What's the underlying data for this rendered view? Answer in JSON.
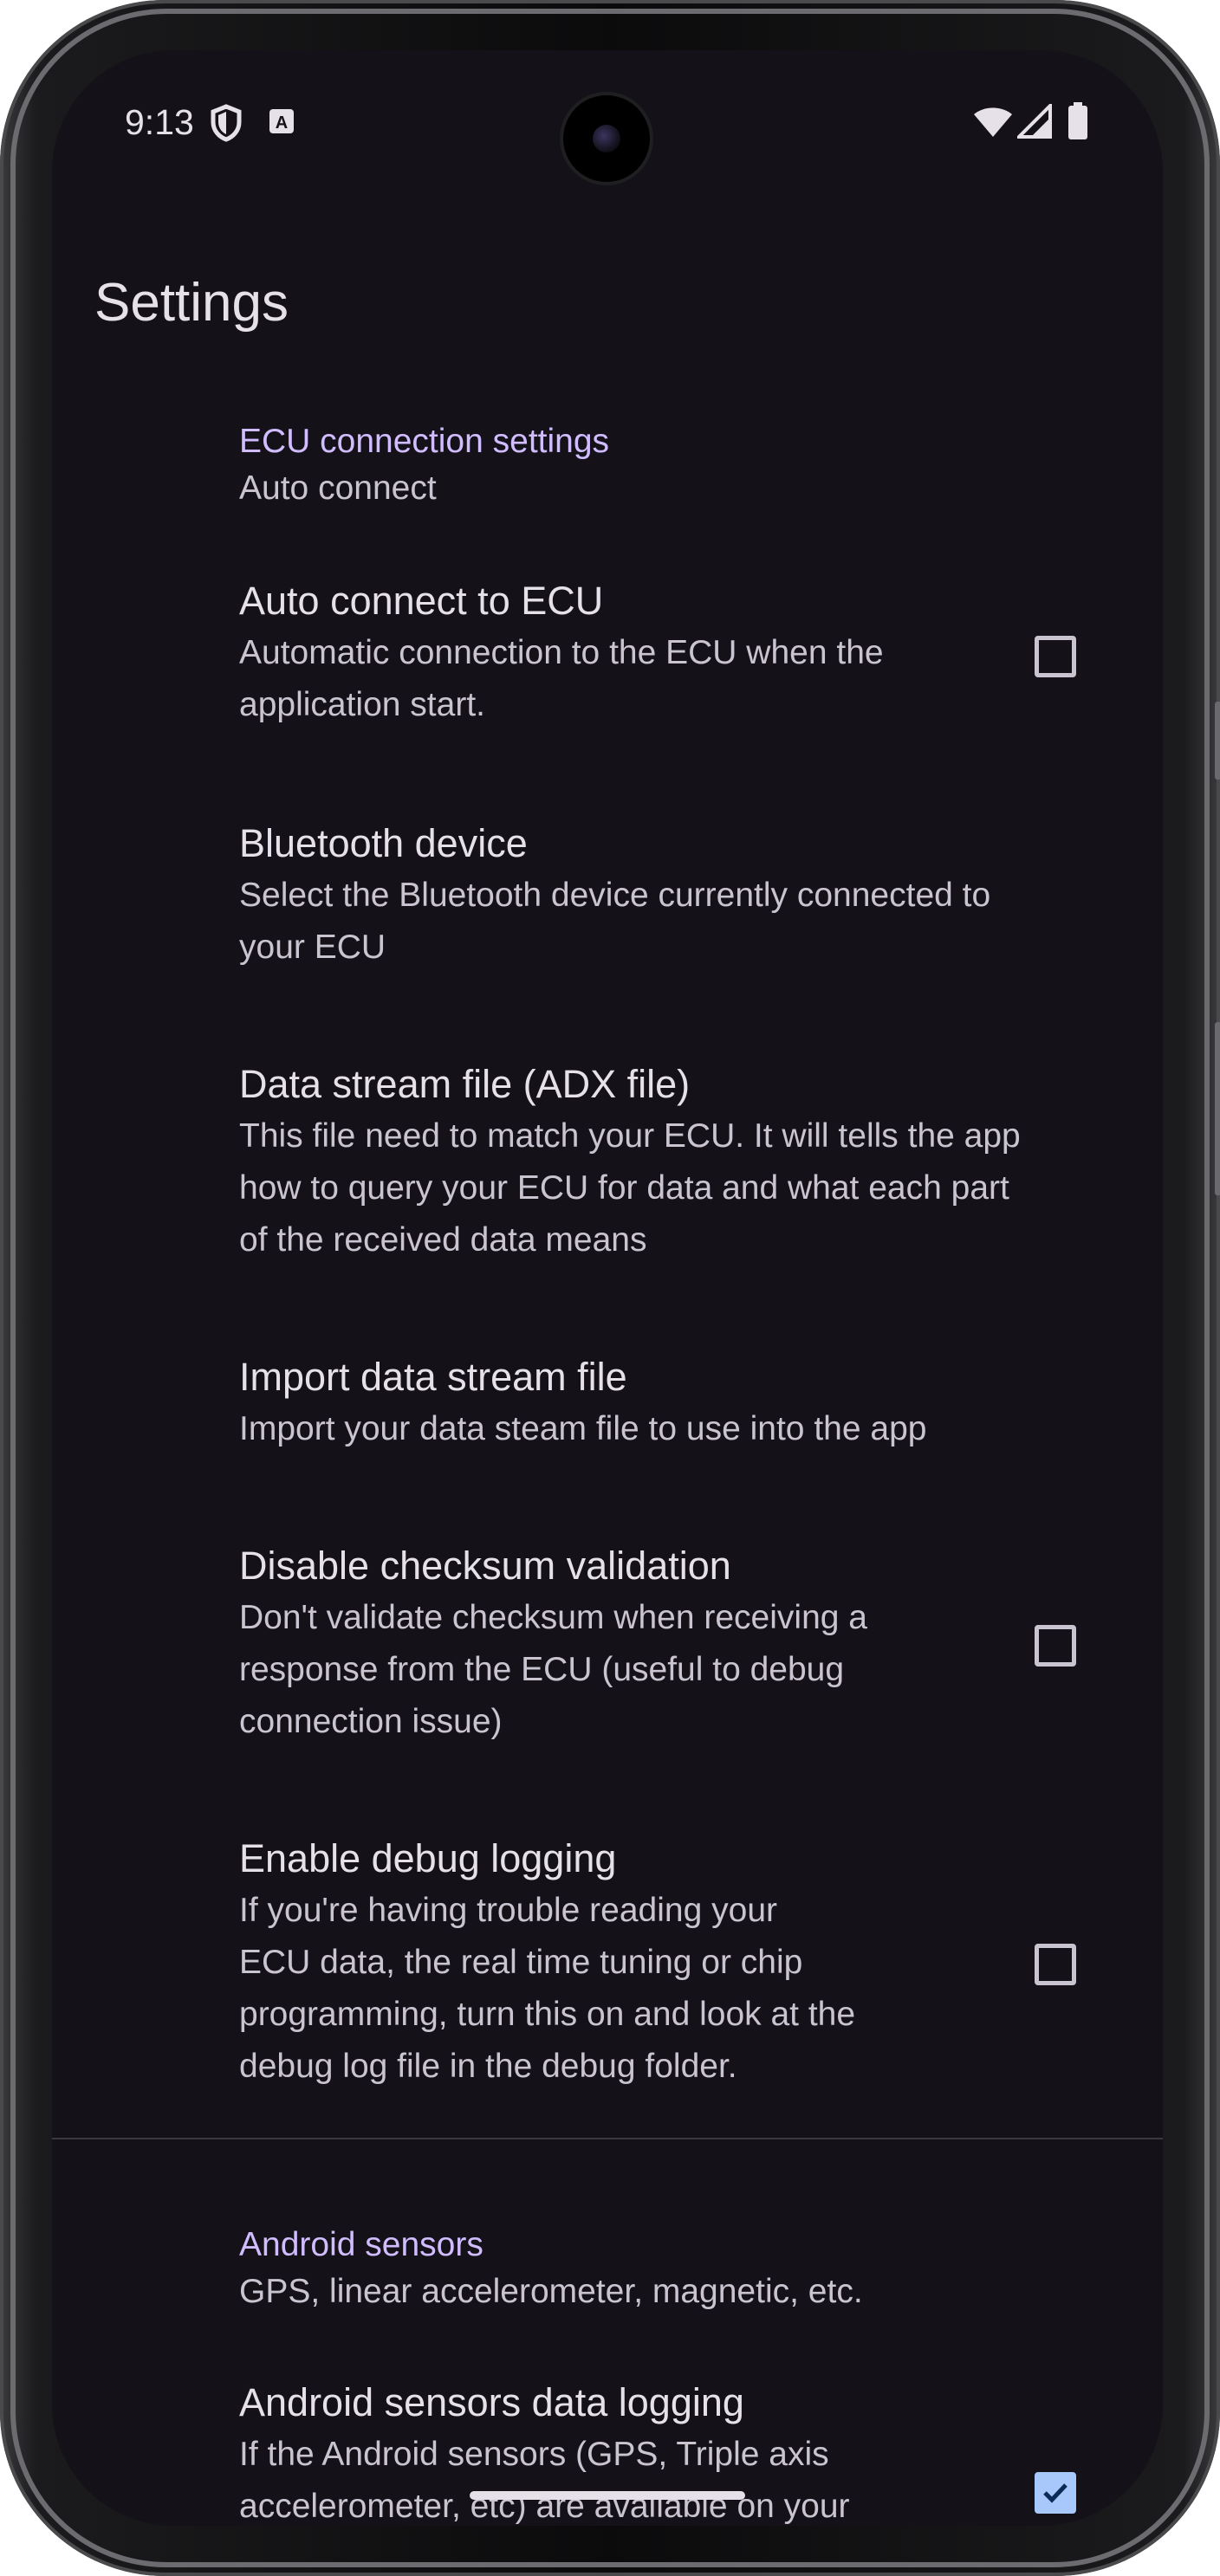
{
  "status_bar": {
    "time": "9:13",
    "left_icons": [
      "shield-icon",
      "accessibility-a-icon"
    ],
    "right_icons": [
      "wifi-icon",
      "cellular-signal-icon",
      "battery-icon"
    ]
  },
  "page": {
    "title": "Settings"
  },
  "categories": [
    {
      "title": "ECU connection settings",
      "subtitle": "Auto connect"
    },
    {
      "title": "Android sensors",
      "subtitle": "GPS, linear accelerometer, magnetic, etc."
    }
  ],
  "preferences": [
    {
      "title": "Auto connect to ECU",
      "summary_lines": [
        "Automatic connection to the ECU when the",
        "application start."
      ],
      "checkbox": true,
      "checked": false
    },
    {
      "title": "Bluetooth device",
      "summary_lines": [
        "Select the Bluetooth device currently connected to",
        "your ECU"
      ],
      "checkbox": false
    },
    {
      "title": "Data stream file (ADX file)",
      "summary_lines": [
        "This file need to match your ECU. It will tells the app",
        "how to query your ECU for data and what each part",
        "of the received data means"
      ],
      "checkbox": false
    },
    {
      "title": "Import data stream file",
      "summary_lines": [
        "Import your data steam file to use into the app"
      ],
      "checkbox": false
    },
    {
      "title": "Disable checksum validation",
      "summary_lines": [
        "Don't validate checksum when receiving a",
        "response from the ECU (useful to debug",
        "connection issue)"
      ],
      "checkbox": true,
      "checked": false
    },
    {
      "title": "Enable debug logging",
      "summary_lines": [
        "If you're having trouble reading your",
        "ECU data, the real time tuning or chip",
        "programming, turn this on and look at the",
        "debug log file in the debug folder."
      ],
      "checkbox": true,
      "checked": false
    },
    {
      "title": "Android sensors data logging",
      "summary_lines": [
        "If the Android sensors (GPS, Triple axis",
        "accelerometer, etc) are available on your"
      ],
      "checkbox": true,
      "checked": true
    }
  ],
  "colors": {
    "background": "#141218",
    "accent": "#d0bcff",
    "checkbox_checked": "#a8c7fa"
  }
}
